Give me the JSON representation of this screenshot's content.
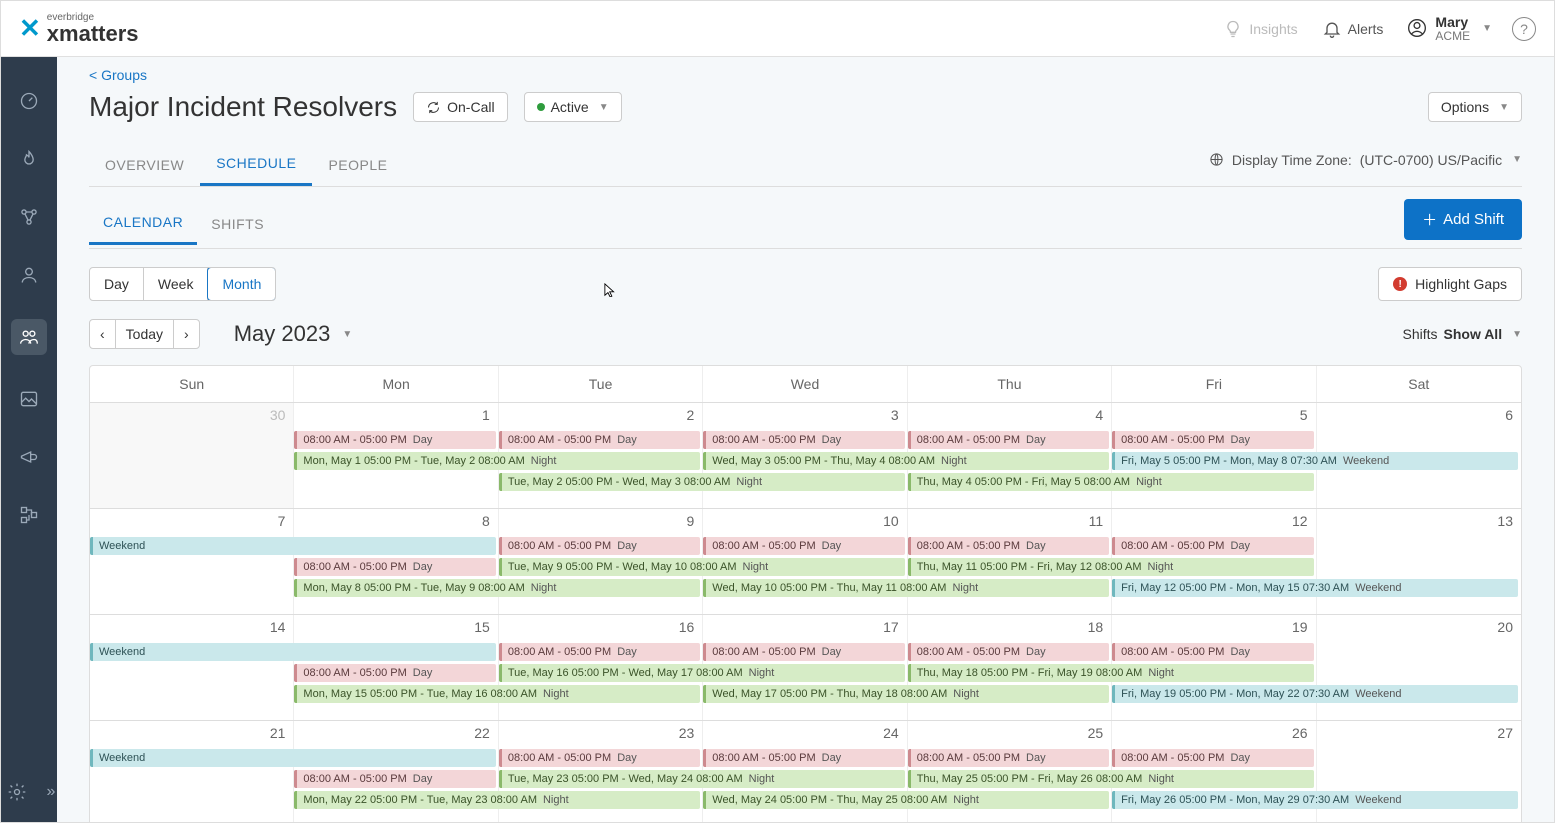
{
  "brand": {
    "sub": "everbridge",
    "main": "xmatters"
  },
  "topbar": {
    "insights": "Insights",
    "alerts": "Alerts",
    "user_name": "Mary",
    "user_org": "ACME",
    "help": "?"
  },
  "breadcrumb": "< Groups",
  "page_title": "Major Incident Resolvers",
  "oncall_label": "On-Call",
  "status_label": "Active",
  "options_label": "Options",
  "tabs": {
    "overview": "OVERVIEW",
    "schedule": "SCHEDULE",
    "people": "PEOPLE"
  },
  "tz_label": "Display Time Zone:",
  "tz_value": "(UTC-0700) US/Pacific",
  "subtabs": {
    "calendar": "CALENDAR",
    "shifts": "SHIFTS"
  },
  "add_shift": "Add Shift",
  "view_seg": {
    "day": "Day",
    "week": "Week",
    "month": "Month"
  },
  "highlight_gaps": "Highlight Gaps",
  "today": "Today",
  "month_label": "May 2023",
  "shifts_label": "Shifts",
  "shifts_value": "Show All",
  "dow": [
    "Sun",
    "Mon",
    "Tue",
    "Wed",
    "Thu",
    "Fri",
    "Sat"
  ],
  "weeks": [
    {
      "days": [
        "30",
        "1",
        "2",
        "3",
        "4",
        "5",
        "6"
      ],
      "dim": [
        true,
        false,
        false,
        false,
        false,
        false,
        false
      ],
      "events": [
        {
          "type": "pink",
          "start": 1,
          "end": 2,
          "row": 0,
          "t1": "08:00 AM - 05:00 PM",
          "t2": "Day"
        },
        {
          "type": "pink",
          "start": 2,
          "end": 3,
          "row": 0,
          "t1": "08:00 AM - 05:00 PM",
          "t2": "Day"
        },
        {
          "type": "pink",
          "start": 3,
          "end": 4,
          "row": 0,
          "t1": "08:00 AM - 05:00 PM",
          "t2": "Day"
        },
        {
          "type": "pink",
          "start": 4,
          "end": 5,
          "row": 0,
          "t1": "08:00 AM - 05:00 PM",
          "t2": "Day"
        },
        {
          "type": "pink",
          "start": 5,
          "end": 6,
          "row": 0,
          "t1": "08:00 AM - 05:00 PM",
          "t2": "Day"
        },
        {
          "type": "green",
          "start": 1,
          "end": 3,
          "row": 1,
          "t1": "Mon, May 1 05:00 PM - Tue, May 2 08:00 AM",
          "t2": "Night"
        },
        {
          "type": "green",
          "start": 3,
          "end": 5,
          "row": 1,
          "t1": "Wed, May 3 05:00 PM - Thu, May 4 08:00 AM",
          "t2": "Night"
        },
        {
          "type": "teal",
          "start": 5,
          "end": 7,
          "row": 1,
          "t1": "Fri, May 5 05:00 PM - Mon, May 8 07:30 AM",
          "t2": "Weekend"
        },
        {
          "type": "green",
          "start": 2,
          "end": 4,
          "row": 2,
          "t1": "Tue, May 2 05:00 PM - Wed, May 3 08:00 AM",
          "t2": "Night"
        },
        {
          "type": "green",
          "start": 4,
          "end": 6,
          "row": 2,
          "t1": "Thu, May 4 05:00 PM - Fri, May 5 08:00 AM",
          "t2": "Night"
        }
      ]
    },
    {
      "days": [
        "7",
        "8",
        "9",
        "10",
        "11",
        "12",
        "13"
      ],
      "dim": [
        false,
        false,
        false,
        false,
        false,
        false,
        false
      ],
      "events": [
        {
          "type": "teal",
          "start": 0,
          "end": 2,
          "row": 0,
          "t1": "Weekend",
          "t2": ""
        },
        {
          "type": "pink",
          "start": 2,
          "end": 3,
          "row": 0,
          "t1": "08:00 AM - 05:00 PM",
          "t2": "Day"
        },
        {
          "type": "pink",
          "start": 3,
          "end": 4,
          "row": 0,
          "t1": "08:00 AM - 05:00 PM",
          "t2": "Day"
        },
        {
          "type": "pink",
          "start": 4,
          "end": 5,
          "row": 0,
          "t1": "08:00 AM - 05:00 PM",
          "t2": "Day"
        },
        {
          "type": "pink",
          "start": 5,
          "end": 6,
          "row": 0,
          "t1": "08:00 AM - 05:00 PM",
          "t2": "Day"
        },
        {
          "type": "pink",
          "start": 1,
          "end": 2,
          "row": 1,
          "t1": "08:00 AM - 05:00 PM",
          "t2": "Day"
        },
        {
          "type": "green",
          "start": 2,
          "end": 4,
          "row": 1,
          "t1": "Tue, May 9 05:00 PM - Wed, May 10 08:00 AM",
          "t2": "Night"
        },
        {
          "type": "green",
          "start": 4,
          "end": 6,
          "row": 1,
          "t1": "Thu, May 11 05:00 PM - Fri, May 12 08:00 AM",
          "t2": "Night"
        },
        {
          "type": "green",
          "start": 1,
          "end": 3,
          "row": 2,
          "t1": "Mon, May 8 05:00 PM - Tue, May 9 08:00 AM",
          "t2": "Night"
        },
        {
          "type": "green",
          "start": 3,
          "end": 5,
          "row": 2,
          "t1": "Wed, May 10 05:00 PM - Thu, May 11 08:00 AM",
          "t2": "Night"
        },
        {
          "type": "teal",
          "start": 5,
          "end": 7,
          "row": 2,
          "t1": "Fri, May 12 05:00 PM - Mon, May 15 07:30 AM",
          "t2": "Weekend"
        }
      ]
    },
    {
      "days": [
        "14",
        "15",
        "16",
        "17",
        "18",
        "19",
        "20"
      ],
      "dim": [
        false,
        false,
        false,
        false,
        false,
        false,
        false
      ],
      "events": [
        {
          "type": "teal",
          "start": 0,
          "end": 2,
          "row": 0,
          "t1": "Weekend",
          "t2": ""
        },
        {
          "type": "pink",
          "start": 2,
          "end": 3,
          "row": 0,
          "t1": "08:00 AM - 05:00 PM",
          "t2": "Day"
        },
        {
          "type": "pink",
          "start": 3,
          "end": 4,
          "row": 0,
          "t1": "08:00 AM - 05:00 PM",
          "t2": "Day"
        },
        {
          "type": "pink",
          "start": 4,
          "end": 5,
          "row": 0,
          "t1": "08:00 AM - 05:00 PM",
          "t2": "Day"
        },
        {
          "type": "pink",
          "start": 5,
          "end": 6,
          "row": 0,
          "t1": "08:00 AM - 05:00 PM",
          "t2": "Day"
        },
        {
          "type": "pink",
          "start": 1,
          "end": 2,
          "row": 1,
          "t1": "08:00 AM - 05:00 PM",
          "t2": "Day"
        },
        {
          "type": "green",
          "start": 2,
          "end": 4,
          "row": 1,
          "t1": "Tue, May 16 05:00 PM - Wed, May 17 08:00 AM",
          "t2": "Night"
        },
        {
          "type": "green",
          "start": 4,
          "end": 6,
          "row": 1,
          "t1": "Thu, May 18 05:00 PM - Fri, May 19 08:00 AM",
          "t2": "Night"
        },
        {
          "type": "green",
          "start": 1,
          "end": 3,
          "row": 2,
          "t1": "Mon, May 15 05:00 PM - Tue, May 16 08:00 AM",
          "t2": "Night"
        },
        {
          "type": "green",
          "start": 3,
          "end": 5,
          "row": 2,
          "t1": "Wed, May 17 05:00 PM - Thu, May 18 08:00 AM",
          "t2": "Night"
        },
        {
          "type": "teal",
          "start": 5,
          "end": 7,
          "row": 2,
          "t1": "Fri, May 19 05:00 PM - Mon, May 22 07:30 AM",
          "t2": "Weekend"
        }
      ]
    },
    {
      "days": [
        "21",
        "22",
        "23",
        "24",
        "25",
        "26",
        "27"
      ],
      "dim": [
        false,
        false,
        false,
        false,
        false,
        false,
        false
      ],
      "events": [
        {
          "type": "teal",
          "start": 0,
          "end": 2,
          "row": 0,
          "t1": "Weekend",
          "t2": ""
        },
        {
          "type": "pink",
          "start": 2,
          "end": 3,
          "row": 0,
          "t1": "08:00 AM - 05:00 PM",
          "t2": "Day"
        },
        {
          "type": "pink",
          "start": 3,
          "end": 4,
          "row": 0,
          "t1": "08:00 AM - 05:00 PM",
          "t2": "Day"
        },
        {
          "type": "pink",
          "start": 4,
          "end": 5,
          "row": 0,
          "t1": "08:00 AM - 05:00 PM",
          "t2": "Day"
        },
        {
          "type": "pink",
          "start": 5,
          "end": 6,
          "row": 0,
          "t1": "08:00 AM - 05:00 PM",
          "t2": "Day"
        },
        {
          "type": "pink",
          "start": 1,
          "end": 2,
          "row": 1,
          "t1": "08:00 AM - 05:00 PM",
          "t2": "Day"
        },
        {
          "type": "green",
          "start": 2,
          "end": 4,
          "row": 1,
          "t1": "Tue, May 23 05:00 PM - Wed, May 24 08:00 AM",
          "t2": "Night"
        },
        {
          "type": "green",
          "start": 4,
          "end": 6,
          "row": 1,
          "t1": "Thu, May 25 05:00 PM - Fri, May 26 08:00 AM",
          "t2": "Night"
        },
        {
          "type": "green",
          "start": 1,
          "end": 3,
          "row": 2,
          "t1": "Mon, May 22 05:00 PM - Tue, May 23 08:00 AM",
          "t2": "Night"
        },
        {
          "type": "green",
          "start": 3,
          "end": 5,
          "row": 2,
          "t1": "Wed, May 24 05:00 PM - Thu, May 25 08:00 AM",
          "t2": "Night"
        },
        {
          "type": "teal",
          "start": 5,
          "end": 7,
          "row": 2,
          "t1": "Fri, May 26 05:00 PM - Mon, May 29 07:30 AM",
          "t2": "Weekend"
        }
      ]
    }
  ]
}
